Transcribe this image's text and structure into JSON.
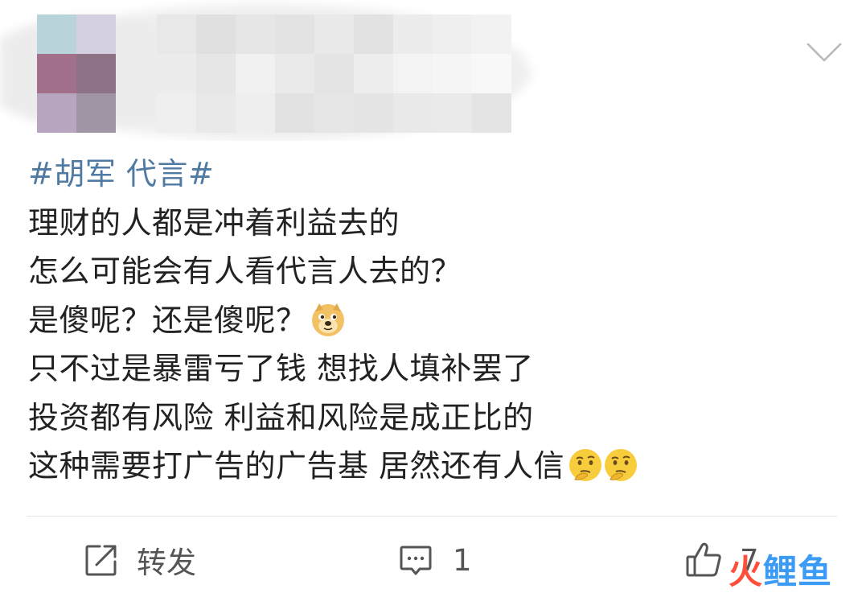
{
  "post": {
    "hashtag": "#胡军 代言#",
    "lines": [
      "理财的人都是冲着利益去的",
      "怎么可能会有人看代言人去的？",
      "是傻呢？还是傻呢？",
      "只不过是暴雷亏了钱  想找人填补罢了",
      "投资都有风险  利益和风险是成正比的",
      "这种需要打广告的广告基  居然还有人信"
    ],
    "emojis": {
      "line3": "doge-emoji",
      "line6": [
        "thinking-emoji",
        "thinking-emoji"
      ]
    }
  },
  "actions": {
    "repost_label": "转发",
    "comment_count": "1",
    "like_count": "7"
  },
  "watermark": {
    "part1": "火",
    "part2": "鲤鱼"
  },
  "icons": {
    "repost": "repost-icon",
    "comment": "comment-icon",
    "like": "thumbs-up-icon",
    "expand": "chevron-down-icon"
  },
  "colors": {
    "hashtag": "#4f7aa3",
    "text": "#222222",
    "action": "#555555"
  }
}
